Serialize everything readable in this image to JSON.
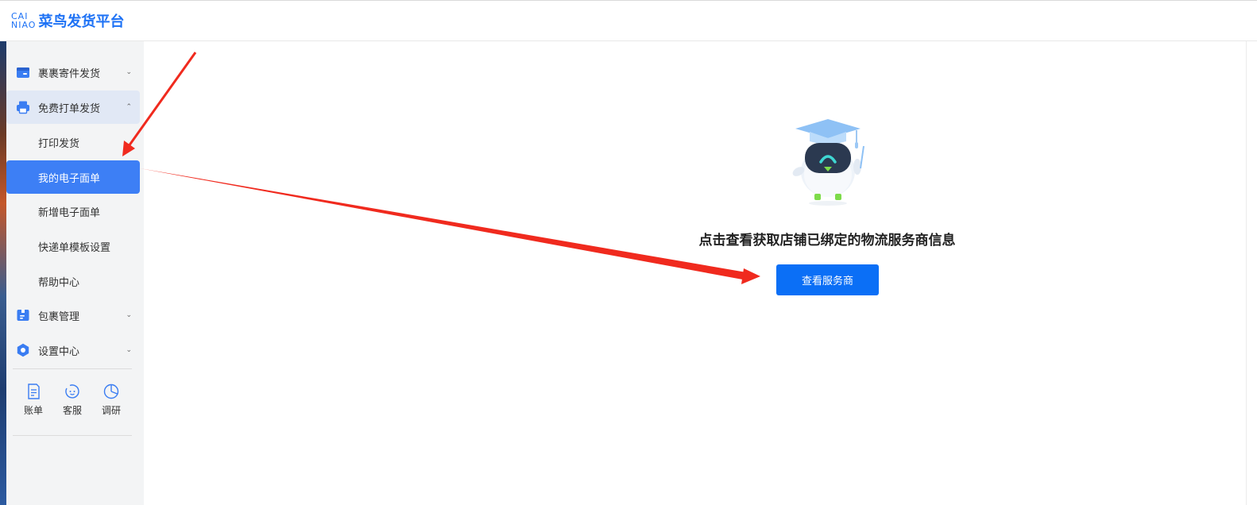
{
  "header": {
    "logo_mark_top": "CAI",
    "logo_mark_bottom": "NIAO",
    "logo_text": "菜鸟发货平台"
  },
  "sidebar": {
    "groups": [
      {
        "label": "裹裹寄件发货",
        "icon": "parcel-send-icon",
        "expanded": false
      },
      {
        "label": "免费打单发货",
        "icon": "printer-icon",
        "expanded": true
      },
      {
        "label": "包裹管理",
        "icon": "package-icon",
        "expanded": false
      },
      {
        "label": "设置中心",
        "icon": "gear-icon",
        "expanded": false
      }
    ],
    "sub_items": [
      {
        "label": "打印发货"
      },
      {
        "label": "我的电子面单",
        "selected": true
      },
      {
        "label": "新增电子面单"
      },
      {
        "label": "快递单模板设置"
      },
      {
        "label": "帮助中心"
      }
    ],
    "quick_links": [
      {
        "label": "账单",
        "icon": "bill-icon"
      },
      {
        "label": "客服",
        "icon": "customer-service-icon"
      },
      {
        "label": "调研",
        "icon": "survey-chart-icon"
      }
    ]
  },
  "main": {
    "prompt": "点击查看获取店铺已绑定的物流服务商信息",
    "button_label": "查看服务商"
  },
  "colors": {
    "accent": "#0b6ff6",
    "selected_item": "#3d7ff5",
    "annotation_arrow": "#f02a1e"
  }
}
